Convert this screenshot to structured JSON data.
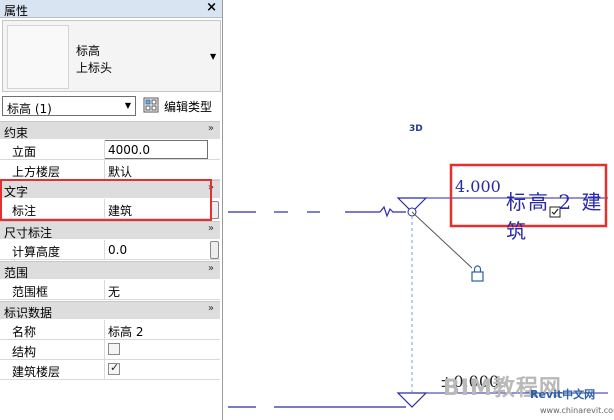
{
  "panel": {
    "title": "属性",
    "close": "×",
    "type_family": "标高",
    "type_name": "上标头",
    "instance_selector": "标高 (1)",
    "edit_type_label": "编辑类型"
  },
  "categories": {
    "constraints": "约束",
    "text": "文字",
    "dimensions": "尺寸标注",
    "extents": "范围",
    "identity": "标识数据"
  },
  "rows": {
    "elevation": {
      "label": "立面",
      "value": "4000.0"
    },
    "story_above": {
      "label": "上方楼层",
      "value": "默认"
    },
    "annotation": {
      "label": "标注",
      "value": "建筑"
    },
    "compute_height": {
      "label": "计算高度",
      "value": "0.0"
    },
    "scope_box": {
      "label": "范围框",
      "value": "无"
    },
    "name": {
      "label": "名称",
      "value": "标高 2"
    },
    "structural": {
      "label": "结构",
      "checked": false
    },
    "building_story": {
      "label": "建筑楼层",
      "checked": true
    }
  },
  "canvas": {
    "view_label": "3D",
    "level2_value": "4.000",
    "level2_name": "标高 2 建筑",
    "level1_value": "±0.000"
  },
  "watermark": {
    "main": "BIM教程网",
    "logo": "Revit中文网",
    "url": "www.chinarevit.com"
  },
  "colors": {
    "level_blue": "#2a2aa8",
    "highlight_red": "#e53030",
    "category_gray": "#dddddd"
  }
}
